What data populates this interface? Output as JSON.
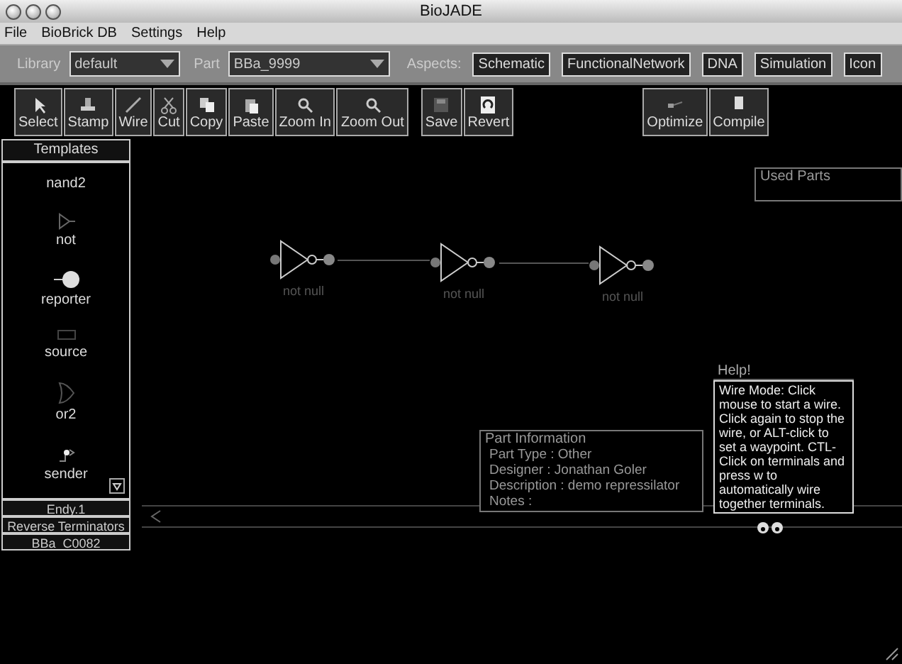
{
  "window": {
    "title": "BioJADE"
  },
  "menu": [
    "File",
    "BioBrick DB",
    "Settings",
    "Help"
  ],
  "library": {
    "label": "Library",
    "value": "default"
  },
  "part": {
    "label": "Part",
    "value": "BBa_9999"
  },
  "aspects": {
    "label": "Aspects:",
    "items": [
      "Schematic",
      "FunctionalNetwork",
      "DNA",
      "Simulation",
      "Icon"
    ]
  },
  "toolbar": [
    [
      {
        "label": "Select",
        "kind": "select"
      },
      {
        "label": "Stamp",
        "kind": "stamp"
      },
      {
        "label": "Wire",
        "kind": "wire"
      },
      {
        "label": "Cut",
        "kind": "cut"
      },
      {
        "label": "Copy",
        "kind": "copy"
      },
      {
        "label": "Paste",
        "kind": "paste"
      },
      {
        "label": "Zoom In",
        "kind": "zoom"
      },
      {
        "label": "Zoom Out",
        "kind": "zoom"
      }
    ],
    [
      {
        "label": "Save",
        "kind": "save"
      },
      {
        "label": "Revert",
        "kind": "revert"
      }
    ],
    [
      {
        "label": "Optimize",
        "kind": "optimize"
      },
      {
        "label": "Compile",
        "kind": "compile"
      }
    ]
  ],
  "templates": {
    "title": "Templates",
    "items": [
      {
        "label": "nand2",
        "kind": "none"
      },
      {
        "label": "not",
        "kind": "not"
      },
      {
        "label": "reporter",
        "kind": "reporter"
      },
      {
        "label": "source",
        "kind": "source"
      },
      {
        "label": "or2",
        "kind": "or"
      },
      {
        "label": "sender",
        "kind": "sender"
      }
    ]
  },
  "libraries": [
    "Endy.1",
    "Reverse Terminators",
    "BBa_C0082"
  ],
  "canvas": {
    "gates": [
      {
        "label": "not null"
      },
      {
        "label": "not null"
      },
      {
        "label": "not null"
      }
    ]
  },
  "used_parts": {
    "title": "Used Parts"
  },
  "part_info": {
    "title": "Part Information",
    "lines": [
      "Part Type : Other",
      "Designer : Jonathan Goler",
      "Description : demo repressilator",
      "Notes :"
    ]
  },
  "help": {
    "title": "Help!",
    "text": "Wire Mode: Click mouse to start a wire. Click again to stop the wire, or ALT-click to set a waypoint. CTL-Click on terminals and press w to automatically wire together terminals."
  }
}
